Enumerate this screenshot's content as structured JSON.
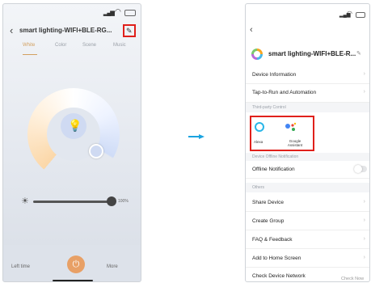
{
  "left_screen": {
    "title": "smart lighting-WIFI+BLE-RG...",
    "back_icon": "chevron-left-icon",
    "edit_icon": "pencil-icon",
    "tabs": [
      {
        "label": "White",
        "active": true
      },
      {
        "label": "Color",
        "active": false
      },
      {
        "label": "Scene",
        "active": false
      },
      {
        "label": "Music",
        "active": false
      }
    ],
    "brightness_label": "100%",
    "brightness_value": 100,
    "bottom_bar": {
      "left_time": "Left time",
      "more": "More"
    },
    "colors": {
      "accent": "#d2a060",
      "power": "#e8a066",
      "highlight_box": "#e0201b"
    }
  },
  "right_screen": {
    "title": "smart lighting-WIFI+BLE-R...",
    "rows": {
      "device_information": "Device Information",
      "tap_to_run": "Tap-to-Run and Automation",
      "offline_notification": "Offline Notification",
      "share_device": "Share Device",
      "create_group": "Create Group",
      "faq": "FAQ & Feedback",
      "add_home": "Add to Home Screen",
      "check_network": "Check Device Network",
      "check_now": "Check Now"
    },
    "sections": {
      "third_party": "Third-party Control",
      "offline": "Device Offline Notification",
      "others": "Others"
    },
    "third_party_services": [
      {
        "name": "Alexa"
      },
      {
        "name": "Google Assistant"
      }
    ],
    "offline_toggle_on": false
  }
}
